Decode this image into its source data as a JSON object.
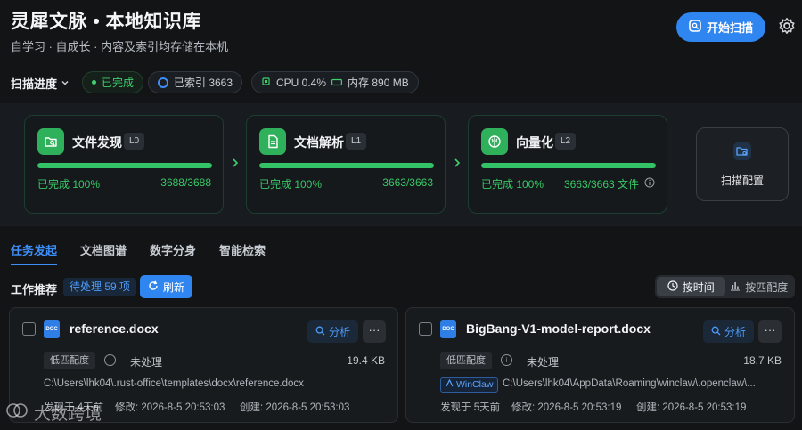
{
  "header": {
    "title": "灵犀文脉 • 本地知识库",
    "subtitle": "自学习 · 自成长 · 内容及索引均存储在本机",
    "scan_button": "开始扫描"
  },
  "status": {
    "label": "扫描进度",
    "done": "已完成",
    "indexed": "已索引 3663",
    "cpu": "CPU 0.4%",
    "memory": "内存 890 MB"
  },
  "pipeline": [
    {
      "title": "文件发现",
      "level": "L0",
      "status": "已完成 100%",
      "count": "3688/3688",
      "progress": 100
    },
    {
      "title": "文档解析",
      "level": "L1",
      "status": "已完成 100%",
      "count": "3663/3663",
      "progress": 100
    },
    {
      "title": "向量化",
      "level": "L2",
      "status": "已完成 100%",
      "count": "3663/3663 文件",
      "progress": 100
    }
  ],
  "scan_config": "扫描配置",
  "tabs": [
    "任务发起",
    "文档图谱",
    "数字分身",
    "智能检索"
  ],
  "work": {
    "title": "工作推荐",
    "pending": "待处理 59 项",
    "refresh": "刷新",
    "sort_time": "按时间",
    "sort_match": "按匹配度"
  },
  "files": [
    {
      "icon": "DOC",
      "name": "reference.docx",
      "analyze": "分析",
      "more": "···",
      "match": "低匹配度",
      "status": "未处理",
      "size": "19.4 KB",
      "path": "C:\\Users\\lhk04\\.rust-office\\templates\\docx\\reference.docx",
      "found": "发现于 4天前",
      "modified": "修改: 2026-8-5 20:53:03",
      "created": "创建: 2026-8-5 20:53:03"
    },
    {
      "icon": "DOC",
      "name": "BigBang-V1-model-report.docx",
      "analyze": "分析",
      "more": "···",
      "match": "低匹配度",
      "status": "未处理",
      "size": "18.7 KB",
      "source": "WinClaw",
      "path": "C:\\Users\\lhk04\\AppData\\Roaming\\winclaw\\.openclaw\\...",
      "found": "发现于 5天前",
      "modified": "修改: 2026-8-5 20:53:19",
      "created": "创建: 2026-8-5 20:53:19"
    }
  ],
  "watermark": "大数跨境",
  "colors": {
    "accent": "#2f86f0",
    "success": "#33c266",
    "background": "#121416"
  }
}
